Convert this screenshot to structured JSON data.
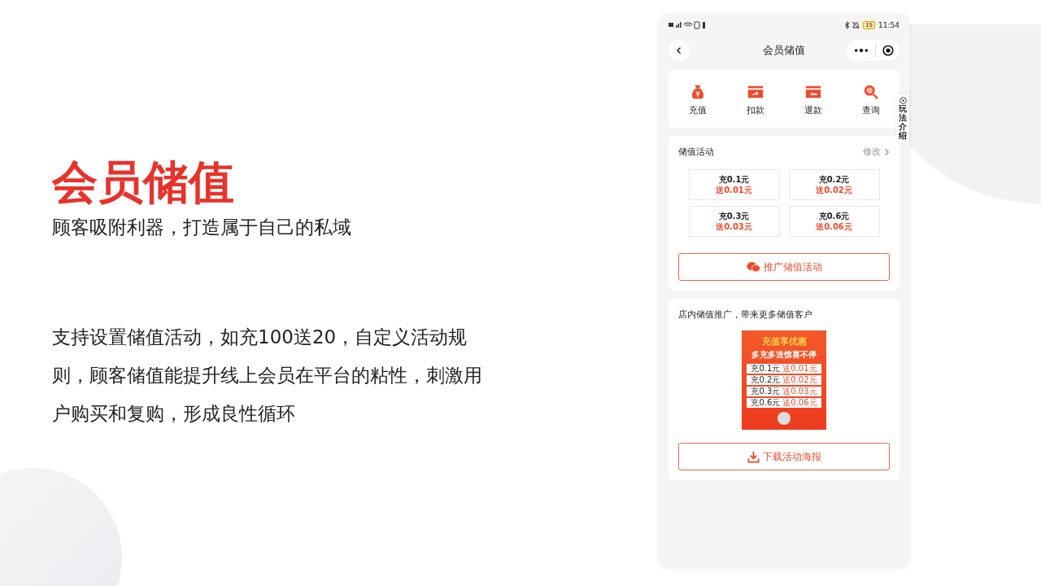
{
  "slide": {
    "title": "会员储值",
    "subtitle": "顾客吸附利器，打造属于自己的私域",
    "paragraph": "支持设置储值活动，如充100送20，自定义活动规则，顾客储值能提升线上会员在平台的粘性，刺激用户购买和复购，形成良性循环"
  },
  "phone": {
    "status_bar": {
      "time": "11:54",
      "battery": "15"
    },
    "nav": {
      "title": "会员储值"
    },
    "actions": [
      {
        "label": "充值"
      },
      {
        "label": "扣款"
      },
      {
        "label": "退款"
      },
      {
        "label": "查询"
      }
    ],
    "side_tab": "玩法介绍",
    "activity": {
      "title": "储值活动",
      "edit": "修改",
      "tiers": [
        {
          "charge": "充0.1元",
          "bonus": "送0.01元"
        },
        {
          "charge": "充0.2元",
          "bonus": "送0.02元"
        },
        {
          "charge": "充0.3元",
          "bonus": "送0.03元"
        },
        {
          "charge": "充0.6元",
          "bonus": "送0.06元"
        }
      ],
      "promote_button": "推广储值活动"
    },
    "poster_section": {
      "title": "店内储值推广，带来更多储值客户",
      "poster": {
        "headline": "充值享优惠",
        "subheadline": "多充多送惊喜不停",
        "rows": [
          {
            "charge": "充0.1元",
            "bonus": "送0.01元"
          },
          {
            "charge": "充0.2元",
            "bonus": "送0.02元"
          },
          {
            "charge": "充0.3元",
            "bonus": "送0.03元"
          },
          {
            "charge": "充0.6元",
            "bonus": "送0.06元"
          }
        ]
      },
      "download_button": "下载活动海报"
    }
  }
}
